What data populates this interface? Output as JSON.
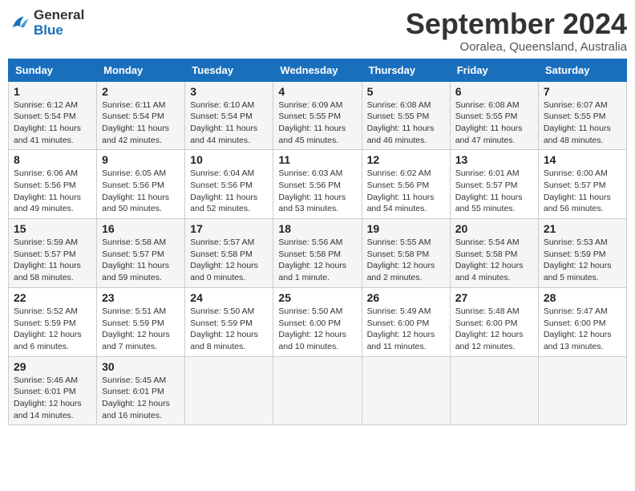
{
  "header": {
    "title": "September 2024",
    "location": "Ooralea, Queensland, Australia",
    "logo_general": "General",
    "logo_blue": "Blue"
  },
  "days_of_week": [
    "Sunday",
    "Monday",
    "Tuesday",
    "Wednesday",
    "Thursday",
    "Friday",
    "Saturday"
  ],
  "weeks": [
    {
      "cells": [
        {
          "day": "1",
          "info": "Sunrise: 6:12 AM\nSunset: 5:54 PM\nDaylight: 11 hours\nand 41 minutes."
        },
        {
          "day": "2",
          "info": "Sunrise: 6:11 AM\nSunset: 5:54 PM\nDaylight: 11 hours\nand 42 minutes."
        },
        {
          "day": "3",
          "info": "Sunrise: 6:10 AM\nSunset: 5:54 PM\nDaylight: 11 hours\nand 44 minutes."
        },
        {
          "day": "4",
          "info": "Sunrise: 6:09 AM\nSunset: 5:55 PM\nDaylight: 11 hours\nand 45 minutes."
        },
        {
          "day": "5",
          "info": "Sunrise: 6:08 AM\nSunset: 5:55 PM\nDaylight: 11 hours\nand 46 minutes."
        },
        {
          "day": "6",
          "info": "Sunrise: 6:08 AM\nSunset: 5:55 PM\nDaylight: 11 hours\nand 47 minutes."
        },
        {
          "day": "7",
          "info": "Sunrise: 6:07 AM\nSunset: 5:55 PM\nDaylight: 11 hours\nand 48 minutes."
        }
      ],
      "parity": "odd"
    },
    {
      "cells": [
        {
          "day": "8",
          "info": "Sunrise: 6:06 AM\nSunset: 5:56 PM\nDaylight: 11 hours\nand 49 minutes."
        },
        {
          "day": "9",
          "info": "Sunrise: 6:05 AM\nSunset: 5:56 PM\nDaylight: 11 hours\nand 50 minutes."
        },
        {
          "day": "10",
          "info": "Sunrise: 6:04 AM\nSunset: 5:56 PM\nDaylight: 11 hours\nand 52 minutes."
        },
        {
          "day": "11",
          "info": "Sunrise: 6:03 AM\nSunset: 5:56 PM\nDaylight: 11 hours\nand 53 minutes."
        },
        {
          "day": "12",
          "info": "Sunrise: 6:02 AM\nSunset: 5:56 PM\nDaylight: 11 hours\nand 54 minutes."
        },
        {
          "day": "13",
          "info": "Sunrise: 6:01 AM\nSunset: 5:57 PM\nDaylight: 11 hours\nand 55 minutes."
        },
        {
          "day": "14",
          "info": "Sunrise: 6:00 AM\nSunset: 5:57 PM\nDaylight: 11 hours\nand 56 minutes."
        }
      ],
      "parity": "even"
    },
    {
      "cells": [
        {
          "day": "15",
          "info": "Sunrise: 5:59 AM\nSunset: 5:57 PM\nDaylight: 11 hours\nand 58 minutes."
        },
        {
          "day": "16",
          "info": "Sunrise: 5:58 AM\nSunset: 5:57 PM\nDaylight: 11 hours\nand 59 minutes."
        },
        {
          "day": "17",
          "info": "Sunrise: 5:57 AM\nSunset: 5:58 PM\nDaylight: 12 hours\nand 0 minutes."
        },
        {
          "day": "18",
          "info": "Sunrise: 5:56 AM\nSunset: 5:58 PM\nDaylight: 12 hours\nand 1 minute."
        },
        {
          "day": "19",
          "info": "Sunrise: 5:55 AM\nSunset: 5:58 PM\nDaylight: 12 hours\nand 2 minutes."
        },
        {
          "day": "20",
          "info": "Sunrise: 5:54 AM\nSunset: 5:58 PM\nDaylight: 12 hours\nand 4 minutes."
        },
        {
          "day": "21",
          "info": "Sunrise: 5:53 AM\nSunset: 5:59 PM\nDaylight: 12 hours\nand 5 minutes."
        }
      ],
      "parity": "odd"
    },
    {
      "cells": [
        {
          "day": "22",
          "info": "Sunrise: 5:52 AM\nSunset: 5:59 PM\nDaylight: 12 hours\nand 6 minutes."
        },
        {
          "day": "23",
          "info": "Sunrise: 5:51 AM\nSunset: 5:59 PM\nDaylight: 12 hours\nand 7 minutes."
        },
        {
          "day": "24",
          "info": "Sunrise: 5:50 AM\nSunset: 5:59 PM\nDaylight: 12 hours\nand 8 minutes."
        },
        {
          "day": "25",
          "info": "Sunrise: 5:50 AM\nSunset: 6:00 PM\nDaylight: 12 hours\nand 10 minutes."
        },
        {
          "day": "26",
          "info": "Sunrise: 5:49 AM\nSunset: 6:00 PM\nDaylight: 12 hours\nand 11 minutes."
        },
        {
          "day": "27",
          "info": "Sunrise: 5:48 AM\nSunset: 6:00 PM\nDaylight: 12 hours\nand 12 minutes."
        },
        {
          "day": "28",
          "info": "Sunrise: 5:47 AM\nSunset: 6:00 PM\nDaylight: 12 hours\nand 13 minutes."
        }
      ],
      "parity": "even"
    },
    {
      "cells": [
        {
          "day": "29",
          "info": "Sunrise: 5:46 AM\nSunset: 6:01 PM\nDaylight: 12 hours\nand 14 minutes."
        },
        {
          "day": "30",
          "info": "Sunrise: 5:45 AM\nSunset: 6:01 PM\nDaylight: 12 hours\nand 16 minutes."
        },
        {
          "day": "",
          "info": ""
        },
        {
          "day": "",
          "info": ""
        },
        {
          "day": "",
          "info": ""
        },
        {
          "day": "",
          "info": ""
        },
        {
          "day": "",
          "info": ""
        }
      ],
      "parity": "odd"
    }
  ]
}
